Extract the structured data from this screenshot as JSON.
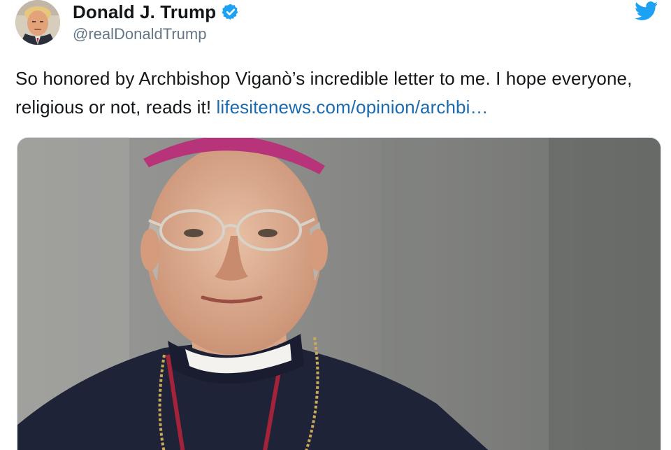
{
  "author": {
    "display_name": "Donald J. Trump",
    "handle": "@realDonaldTrump",
    "verified": true,
    "avatar_icon": "profile-photo"
  },
  "brand": {
    "icon": "twitter-bird-icon",
    "color": "#1da1f2"
  },
  "tweet": {
    "text": "So honored by Archbishop Viganò’s incredible letter to me. I hope everyone, religious or not, reads it! ",
    "link_text": "lifesitenews.com/opinion/archbi…",
    "link_color": "#1b6ab0"
  },
  "media": {
    "type": "photo",
    "subject": "portrait-photo"
  },
  "colors": {
    "text": "#14171a",
    "secondary": "#657786",
    "verified": "#1da1f2"
  }
}
